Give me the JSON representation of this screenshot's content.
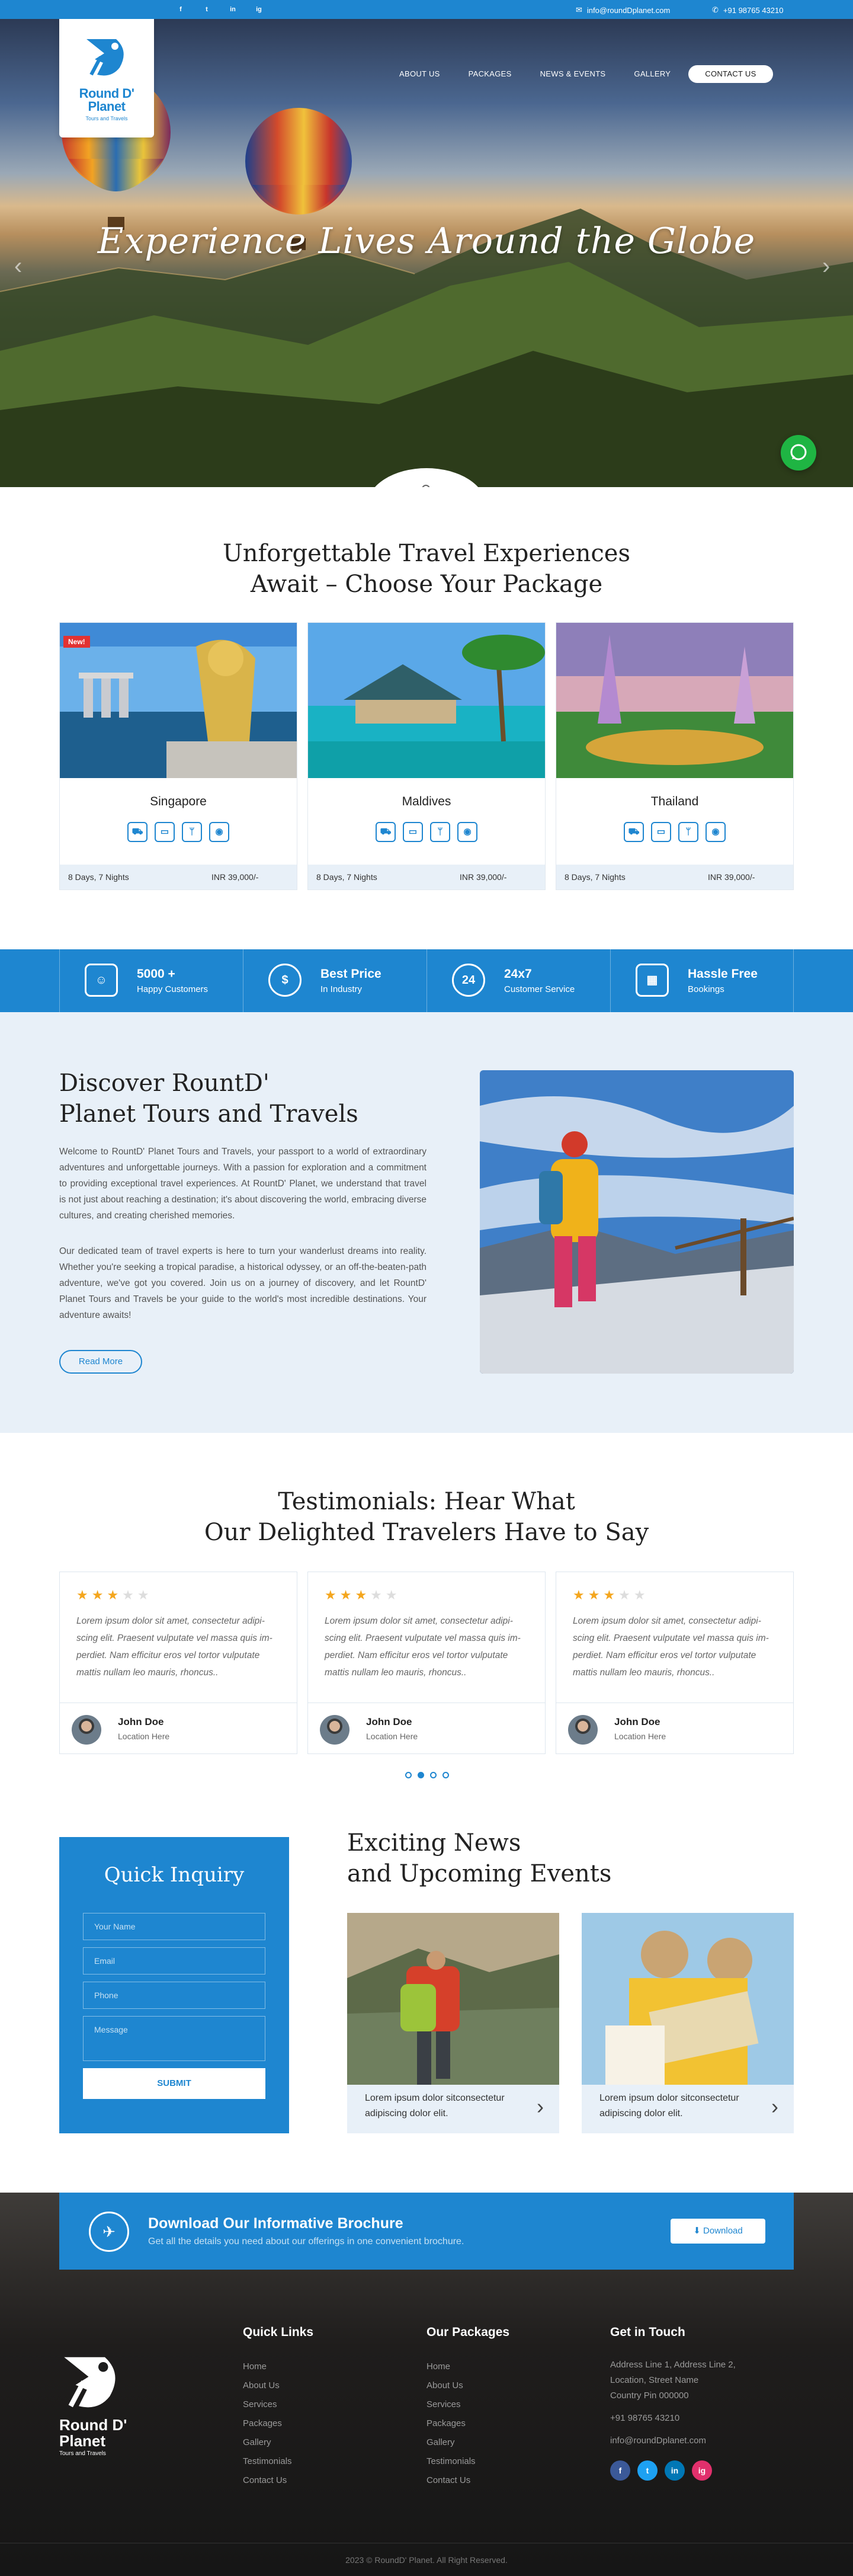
{
  "topbar": {
    "social": [
      "f",
      "t",
      "in",
      "ig"
    ],
    "email": "info@roundDplanet.com",
    "phone": "+91 98765 43210"
  },
  "logo": {
    "name_line1": "Round D'",
    "name_line2": "Planet",
    "tagline": "Tours and Travels"
  },
  "nav": {
    "about": "ABOUT US",
    "packages": "PACKAGES",
    "news": "NEWS & EVENTS",
    "gallery": "GALLERY",
    "contact": "CONTACT US"
  },
  "hero": {
    "title": "Experience Lives Around the Globe"
  },
  "packages": {
    "title_line1": "Unforgettable Travel Experiences",
    "title_line2": "Await – Choose Your Package",
    "badge": "New!",
    "items": [
      {
        "name": "Singapore",
        "duration": "8 Days, 7 Nights",
        "price": "INR 39,000/-"
      },
      {
        "name": "Maldives",
        "duration": "8 Days, 7 Nights",
        "price": "INR 39,000/-"
      },
      {
        "name": "Thailand",
        "duration": "8 Days, 7 Nights",
        "price": "INR 39,000/-"
      }
    ]
  },
  "stats": [
    {
      "title": "5000 +",
      "sub": "Happy Customers",
      "icon": "group-icon"
    },
    {
      "title": "Best Price",
      "sub": "In Industry",
      "icon": "medal-icon"
    },
    {
      "title": "24x7",
      "sub": "Customer Service",
      "icon": "clock-24-icon"
    },
    {
      "title": "Hassle Free",
      "sub": "Bookings",
      "icon": "calendar-icon"
    }
  ],
  "about": {
    "title_line1": "Discover RountD'",
    "title_line2": "Planet Tours and Travels",
    "para1": "Welcome to RountD' Planet Tours and Travels, your passport to a world of extraordinary adventures and unforgettable journeys. With a passion for exploration and a commitment to providing exceptional travel experiences. At RountD' Planet, we understand that travel is not just about reaching a destination; it's about discovering the world, embracing diverse cultures, and creating cherished memories.",
    "para2": "Our dedicated team of travel experts is here to turn your wanderlust dreams into reality. Whether you're seeking a tropical paradise, a historical odyssey, or an off-the-beaten-path adventure, we've got you covered. Join us on a journey of discovery, and let RountD' Planet Tours and Travels be your guide to the world's most incredible destinations. Your adventure awaits!",
    "button": "Read More"
  },
  "testimonials": {
    "title_line1": "Testimonials: Hear What",
    "title_line2": "Our Delighted Travelers Have to Say",
    "items": [
      {
        "rating": 3,
        "quote": "Lorem ipsum dolor sit amet, consectetur adipi-scing elit. Praesent vulputate vel massa quis im-perdiet. Nam efficitur eros vel tortor vulputate mattis nullam leo mauris, rhoncus..",
        "name": "John Doe",
        "location": "Location Here"
      },
      {
        "rating": 3,
        "quote": "Lorem ipsum dolor sit amet, consectetur adipi-scing elit. Praesent vulputate vel massa quis im-perdiet. Nam efficitur eros vel tortor vulputate mattis nullam leo mauris, rhoncus..",
        "name": "John Doe",
        "location": "Location Here"
      },
      {
        "rating": 3,
        "quote": "Lorem ipsum dolor sit amet, consectetur adipi-scing elit. Praesent vulputate vel massa quis im-perdiet. Nam efficitur eros vel tortor vulputate mattis nullam leo mauris, rhoncus..",
        "name": "John Doe",
        "location": "Location Here"
      }
    ],
    "active_dot": 1
  },
  "inquiry": {
    "title": "Quick Inquiry",
    "name_ph": "Your Name",
    "email_ph": "Email",
    "phone_ph": "Phone",
    "message_ph": "Message",
    "submit": "SUBMIT"
  },
  "news": {
    "title_line1": "Exciting News",
    "title_line2": "and Upcoming Events",
    "items": [
      {
        "text": "Lorem ipsum dolor sitconsectetur adipiscing dolor elit."
      },
      {
        "text": "Lorem ipsum dolor sitconsectetur adipiscing dolor elit."
      }
    ]
  },
  "brochure": {
    "title": "Download Our Informative Brochure",
    "sub": "Get all the details you need about our offerings in one convenient brochure.",
    "button": "Download"
  },
  "footer": {
    "quick_links_title": "Quick Links",
    "quick_links": [
      "Home",
      "About Us",
      "Services",
      "Packages",
      "Gallery",
      "Testimonials",
      "Contact Us"
    ],
    "packages_title": "Our Packages",
    "packages": [
      "Home",
      "About Us",
      "Services",
      "Packages",
      "Gallery",
      "Testimonials",
      "Contact Us"
    ],
    "contact_title": "Get in Touch",
    "address1": "Address Line 1, Address Line 2,",
    "address2": "Location, Street Name",
    "address3": "Country Pin 000000",
    "phone": "+91 98765 43210",
    "email": "info@roundDplanet.com",
    "social_colors": [
      "#3b5998",
      "#1da1f2",
      "#0077b5",
      "#e1306c"
    ],
    "copyright": "2023 © RoundD' Planet. All Right Reserved."
  },
  "colors": {
    "accent": "#1e86d0",
    "whatsapp": "#1fb543",
    "star": "#f4a61e"
  }
}
